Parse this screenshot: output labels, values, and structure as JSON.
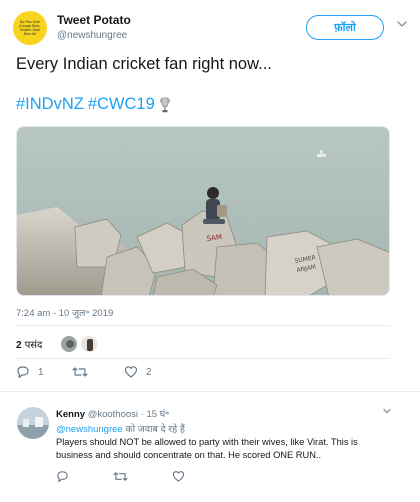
{
  "tweet": {
    "author_name": "Tweet Potato",
    "author_handle": "@newshungree",
    "avatar_text": "Do Pao Kum Jhappe Bala, Shabhi Daal Bola Ka",
    "follow_label": "फ़ॉलो",
    "text": "Every Indian cricket fan right now...",
    "hashtags": [
      "#INDvNZ",
      "#CWC19"
    ],
    "timestamp": "7:24 am - 10 जुल॰ 2019",
    "likes_count": "2",
    "likes_label": "पसंद",
    "reply_count": "1",
    "retweet_count": "",
    "like_count": "2"
  },
  "reply": {
    "author_name": "Kenny",
    "author_handle": "@koothoosi",
    "time": "· 15 घं॰",
    "replying_mention": "@newshungree",
    "replying_suffix": " को जवाब दे रहे हैं",
    "text": "Players should NOT be allowed to party with their wives, like Virat. This is business and should concentrate on that. He scored ONE RUN.."
  },
  "icons": {
    "chevron": "chevron-down-icon",
    "reply": "reply-icon",
    "retweet": "retweet-icon",
    "like": "heart-icon",
    "trophy": "trophy-icon"
  },
  "colors": {
    "accent": "#1da1f2",
    "text": "#14171a",
    "muted": "#657786",
    "avatar_bg": "#f7d51f"
  }
}
